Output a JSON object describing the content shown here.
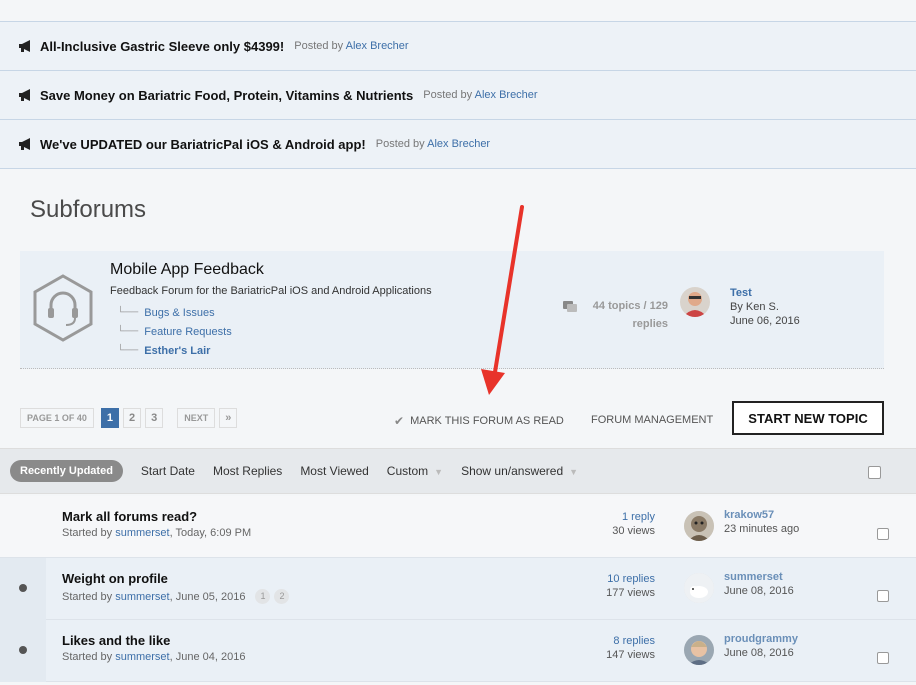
{
  "announcements": [
    {
      "title": "All-Inclusive Gastric Sleeve only $4399!",
      "posted_by_label": "Posted by",
      "author": "Alex Brecher"
    },
    {
      "title": "Save Money on Bariatric Food, Protein, Vitamins & Nutrients",
      "posted_by_label": "Posted by",
      "author": "Alex Brecher"
    },
    {
      "title": "We've UPDATED our BariatricPal iOS & Android app!",
      "posted_by_label": "Posted by",
      "author": "Alex Brecher"
    }
  ],
  "subforums": {
    "heading": "Subforums",
    "forum": {
      "name": "Mobile App Feedback",
      "description": "Feedback Forum for the BariatricPal iOS and Android Applications",
      "children": [
        "Bugs & Issues",
        "Feature Requests",
        "Esther's Lair"
      ],
      "stats_line1": "44 topics / 129",
      "stats_line2": "replies",
      "last_post": {
        "title": "Test",
        "by": "By Ken S.",
        "date": "June 06, 2016"
      }
    }
  },
  "pagination": {
    "info": "PAGE 1 OF 40",
    "pages": [
      "1",
      "2",
      "3"
    ],
    "next": "NEXT",
    "last": "»"
  },
  "actions": {
    "mark_read": "MARK THIS FORUM AS READ",
    "forum_management": "FORUM MANAGEMENT",
    "start_topic": "START NEW TOPIC"
  },
  "filters": {
    "active": "Recently Updated",
    "items": [
      "Start Date",
      "Most Replies",
      "Most Viewed",
      "Custom",
      "Show un/answered"
    ]
  },
  "topics": [
    {
      "title": "Mark all forums read?",
      "started_by": "Started by",
      "author": "summerset",
      "date": ", Today, 6:09 PM",
      "replies": "1 reply",
      "views": "30 views",
      "last_user": "krakow57",
      "last_time": "23 minutes ago",
      "unread": false,
      "pages": []
    },
    {
      "title": "Weight on profile",
      "started_by": "Started by",
      "author": "summerset",
      "date": ", June 05, 2016",
      "replies": "10 replies",
      "views": "177 views",
      "last_user": "summerset",
      "last_time": "June 08, 2016",
      "unread": true,
      "pages": [
        "1",
        "2"
      ]
    },
    {
      "title": "Likes and the like",
      "started_by": "Started by",
      "author": "summerset",
      "date": ", June 04, 2016",
      "replies": "8 replies",
      "views": "147 views",
      "last_user": "proudgrammy",
      "last_time": "June 08, 2016",
      "unread": true,
      "pages": []
    }
  ],
  "icons": {
    "announcement": "megaphone-icon",
    "forum": "headset-hexagon-icon",
    "stats": "speech-bubbles-icon",
    "mark": "checkmark-icon"
  },
  "colors": {
    "link": "#3d6fa8",
    "arrow": "#e8332a"
  }
}
